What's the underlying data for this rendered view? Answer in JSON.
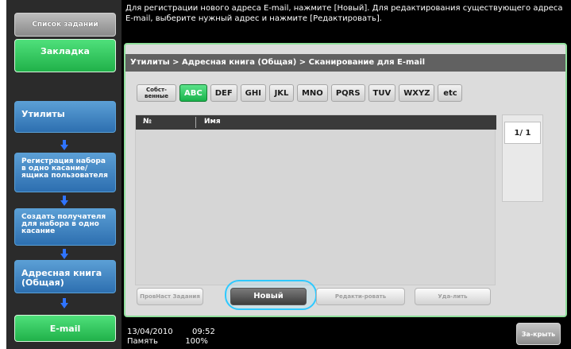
{
  "sidebar": {
    "job_list": "Список заданий",
    "bookmark": "Закладка",
    "steps": {
      "utilities": "Утилиты",
      "one_touch_user_box": "Регистрация набора в одно касание/ящика пользователя",
      "create_one_touch": "Создать получателя для набора в одно касание",
      "address_book": "Адресная книга (Общая)",
      "current": "E-mail"
    }
  },
  "message": "Для регистрации нового адреса E-mail, нажмите [Новый]. Для редактирования существующего адреса E-mail, выберите нужный адрес и нажмите [Редактировать].",
  "breadcrumb": "Утилиты > Адресная книга (Общая) > Сканирование для E-mail",
  "filters": {
    "own": "Собст-венные",
    "items": [
      "ABC",
      "DEF",
      "GHI",
      "JKL",
      "MNO",
      "PQRS",
      "TUV",
      "WXYZ",
      "etc"
    ],
    "active": "ABC"
  },
  "list": {
    "headers": {
      "number": "№",
      "name": "Имя"
    },
    "rows": []
  },
  "pager": {
    "text": "1/ 1"
  },
  "actions": {
    "check_job": "ПровНаст Задания",
    "new": "Новый",
    "edit": "Редакти-ровать",
    "delete": "Уда-лить"
  },
  "footer": {
    "date": "13/04/2010",
    "time": "09:52",
    "memory_label": "Память",
    "memory_value": "100%",
    "close": "За-крыть"
  },
  "colors": {
    "accent_green": "#18b24a",
    "step_blue": "#2d6fb0",
    "arrow_blue": "#2f74ff",
    "halo": "#2ec9ff"
  }
}
